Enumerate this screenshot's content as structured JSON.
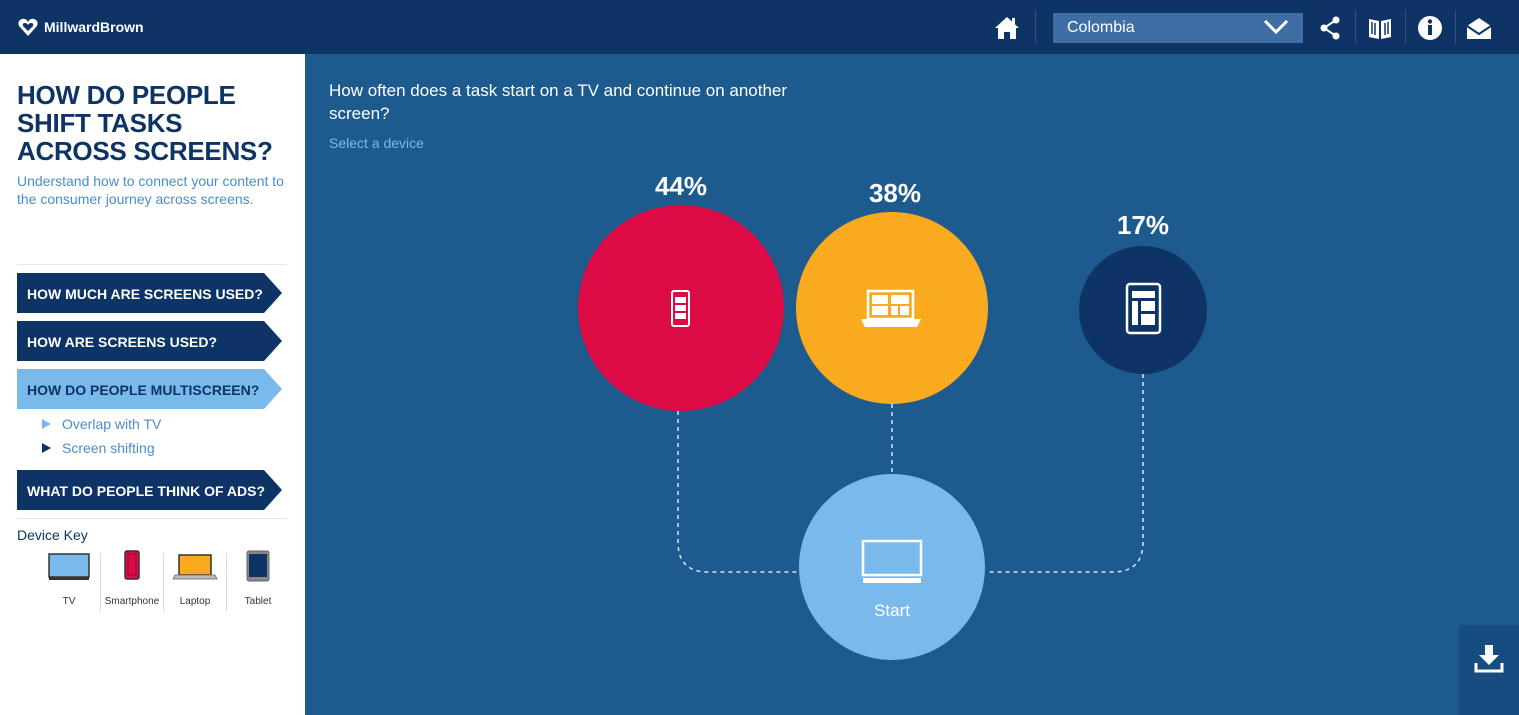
{
  "app": {
    "brand": "MillwardBrown",
    "country": "Colombia"
  },
  "toolbar": {
    "icons": [
      "home-icon",
      "chevron-down-icon",
      "share-icon",
      "book-icon",
      "info-icon",
      "mail-icon"
    ]
  },
  "sidebar": {
    "title": "HOW DO PEOPLE SHIFT TASKS ACROSS SCREENS?",
    "subtitle": "Understand how to connect your content to the consumer journey across screens.",
    "nav": [
      {
        "label": "HOW MUCH ARE SCREENS USED?",
        "active": false
      },
      {
        "label": "HOW ARE SCREENS USED?",
        "active": false
      },
      {
        "label": "HOW DO PEOPLE MULTISCREEN?",
        "active": true
      },
      {
        "label": "WHAT DO PEOPLE THINK OF ADS?",
        "active": false
      }
    ],
    "subnav": [
      {
        "label": "Overlap with TV",
        "current": false
      },
      {
        "label": "Screen shifting",
        "current": true
      }
    ],
    "device_key": {
      "title": "Device Key",
      "items": [
        {
          "label": "TV",
          "icon": "tv-icon",
          "color": "#7ab9ec"
        },
        {
          "label": "Smartphone",
          "icon": "smartphone-icon",
          "color": "#dc0a45"
        },
        {
          "label": "Laptop",
          "icon": "laptop-icon",
          "color": "#f9aa1e"
        },
        {
          "label": "Tablet",
          "icon": "tablet-icon",
          "color": "#0e3465"
        }
      ]
    }
  },
  "main": {
    "question": "How often does a task start on a TV and continue on another screen?",
    "hint": "Select a device",
    "start": {
      "label": "Start",
      "device": "TV",
      "color": "#7ab9ec"
    },
    "devices": [
      {
        "name": "Smartphone",
        "percent": "44%",
        "value": 44,
        "color": "#dc0a45",
        "icon": "smartphone-icon"
      },
      {
        "name": "Laptop",
        "percent": "38%",
        "value": 38,
        "color": "#f9aa1e",
        "icon": "laptop-icon"
      },
      {
        "name": "Tablet",
        "percent": "17%",
        "value": 17,
        "color": "#0e3465",
        "icon": "tablet-icon"
      }
    ]
  },
  "download": {
    "icon": "download-icon"
  }
}
